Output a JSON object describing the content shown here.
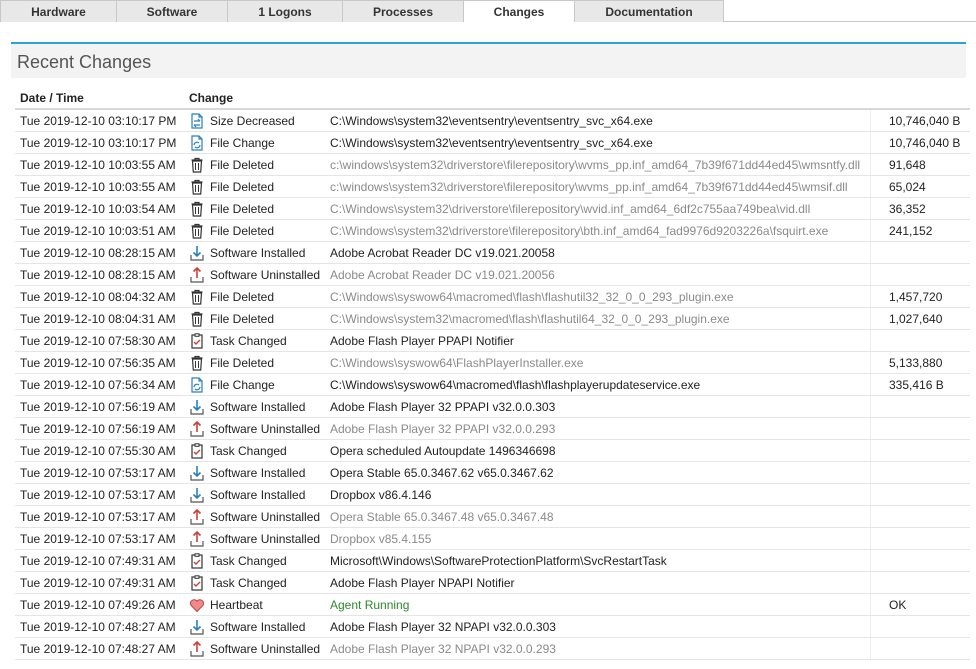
{
  "tabs": [
    {
      "label": "Hardware",
      "active": false
    },
    {
      "label": "Software",
      "active": false
    },
    {
      "label": "1 Logons",
      "active": false
    },
    {
      "label": "Processes",
      "active": false
    },
    {
      "label": "Changes",
      "active": true
    },
    {
      "label": "Documentation",
      "active": false
    }
  ],
  "section": {
    "title": "Recent Changes"
  },
  "table": {
    "headers": {
      "date": "Date / Time",
      "change": "Change"
    },
    "rows": [
      {
        "date": "Tue 2019-12-10 03:10:17 PM",
        "icon": "size-icon",
        "type": "Size Decreased",
        "object": "C:\\Windows\\system32\\eventsentry\\eventsentry_svc_x64.exe",
        "size": "10,746,040 B",
        "style": "normal"
      },
      {
        "date": "Tue 2019-12-10 03:10:17 PM",
        "icon": "file-change-icon",
        "type": "File Change",
        "object": "C:\\Windows\\system32\\eventsentry\\eventsentry_svc_x64.exe",
        "size": "10,746,040 B",
        "style": "normal"
      },
      {
        "date": "Tue 2019-12-10 10:03:55 AM",
        "icon": "trash-icon",
        "type": "File Deleted",
        "object": "c:\\windows\\system32\\driverstore\\filerepository\\wvms_pp.inf_amd64_7b39f671dd44ed45\\wmsntfy.dll",
        "size": "91,648",
        "style": "dim"
      },
      {
        "date": "Tue 2019-12-10 10:03:55 AM",
        "icon": "trash-icon",
        "type": "File Deleted",
        "object": "c:\\windows\\system32\\driverstore\\filerepository\\wvms_pp.inf_amd64_7b39f671dd44ed45\\wmsif.dll",
        "size": "65,024",
        "style": "dim"
      },
      {
        "date": "Tue 2019-12-10 10:03:54 AM",
        "icon": "trash-icon",
        "type": "File Deleted",
        "object": "C:\\Windows\\system32\\driverstore\\filerepository\\wvid.inf_amd64_6df2c755aa749bea\\vid.dll",
        "size": "36,352",
        "style": "dim"
      },
      {
        "date": "Tue 2019-12-10 10:03:51 AM",
        "icon": "trash-icon",
        "type": "File Deleted",
        "object": "C:\\Windows\\system32\\driverstore\\filerepository\\bth.inf_amd64_fad9976d9203226a\\fsquirt.exe",
        "size": "241,152",
        "style": "dim"
      },
      {
        "date": "Tue 2019-12-10 08:28:15 AM",
        "icon": "install-icon",
        "type": "Software Installed",
        "object": "Adobe Acrobat Reader DC v19.021.20058",
        "size": "",
        "style": "normal"
      },
      {
        "date": "Tue 2019-12-10 08:28:15 AM",
        "icon": "uninstall-icon",
        "type": "Software Uninstalled",
        "object": "Adobe Acrobat Reader DC v19.021.20056",
        "size": "",
        "style": "dim"
      },
      {
        "date": "Tue 2019-12-10 08:04:32 AM",
        "icon": "trash-icon",
        "type": "File Deleted",
        "object": "C:\\Windows\\syswow64\\macromed\\flash\\flashutil32_32_0_0_293_plugin.exe",
        "size": "1,457,720",
        "style": "dim"
      },
      {
        "date": "Tue 2019-12-10 08:04:31 AM",
        "icon": "trash-icon",
        "type": "File Deleted",
        "object": "C:\\Windows\\system32\\macromed\\flash\\flashutil64_32_0_0_293_plugin.exe",
        "size": "1,027,640",
        "style": "dim"
      },
      {
        "date": "Tue 2019-12-10 07:58:30 AM",
        "icon": "task-icon",
        "type": "Task Changed",
        "object": "Adobe Flash Player PPAPI Notifier",
        "size": "",
        "style": "normal"
      },
      {
        "date": "Tue 2019-12-10 07:56:35 AM",
        "icon": "trash-icon",
        "type": "File Deleted",
        "object": "C:\\Windows\\syswow64\\FlashPlayerInstaller.exe",
        "size": "5,133,880",
        "style": "dim"
      },
      {
        "date": "Tue 2019-12-10 07:56:34 AM",
        "icon": "file-change-icon",
        "type": "File Change",
        "object": "C:\\Windows\\syswow64\\macromed\\flash\\flashplayerupdateservice.exe",
        "size": "335,416 B",
        "style": "normal"
      },
      {
        "date": "Tue 2019-12-10 07:56:19 AM",
        "icon": "install-icon",
        "type": "Software Installed",
        "object": "Adobe Flash Player 32 PPAPI v32.0.0.303",
        "size": "",
        "style": "normal"
      },
      {
        "date": "Tue 2019-12-10 07:56:19 AM",
        "icon": "uninstall-icon",
        "type": "Software Uninstalled",
        "object": "Adobe Flash Player 32 PPAPI v32.0.0.293",
        "size": "",
        "style": "dim"
      },
      {
        "date": "Tue 2019-12-10 07:55:30 AM",
        "icon": "task-icon",
        "type": "Task Changed",
        "object": "Opera scheduled Autoupdate 1496346698",
        "size": "",
        "style": "normal"
      },
      {
        "date": "Tue 2019-12-10 07:53:17 AM",
        "icon": "install-icon",
        "type": "Software Installed",
        "object": "Opera Stable 65.0.3467.62 v65.0.3467.62",
        "size": "",
        "style": "normal"
      },
      {
        "date": "Tue 2019-12-10 07:53:17 AM",
        "icon": "install-icon",
        "type": "Software Installed",
        "object": "Dropbox v86.4.146",
        "size": "",
        "style": "normal"
      },
      {
        "date": "Tue 2019-12-10 07:53:17 AM",
        "icon": "uninstall-icon",
        "type": "Software Uninstalled",
        "object": "Opera Stable 65.0.3467.48 v65.0.3467.48",
        "size": "",
        "style": "dim"
      },
      {
        "date": "Tue 2019-12-10 07:53:17 AM",
        "icon": "uninstall-icon",
        "type": "Software Uninstalled",
        "object": "Dropbox v85.4.155",
        "size": "",
        "style": "dim"
      },
      {
        "date": "Tue 2019-12-10 07:49:31 AM",
        "icon": "task-icon",
        "type": "Task Changed",
        "object": "Microsoft\\Windows\\SoftwareProtectionPlatform\\SvcRestartTask",
        "size": "",
        "style": "normal"
      },
      {
        "date": "Tue 2019-12-10 07:49:31 AM",
        "icon": "task-icon",
        "type": "Task Changed",
        "object": "Adobe Flash Player NPAPI Notifier",
        "size": "",
        "style": "normal"
      },
      {
        "date": "Tue 2019-12-10 07:49:26 AM",
        "icon": "heart-icon",
        "type": "Heartbeat",
        "object": "Agent Running",
        "size": "OK",
        "style": "green"
      },
      {
        "date": "Tue 2019-12-10 07:48:27 AM",
        "icon": "install-icon",
        "type": "Software Installed",
        "object": "Adobe Flash Player 32 NPAPI v32.0.0.303",
        "size": "",
        "style": "normal"
      },
      {
        "date": "Tue 2019-12-10 07:48:27 AM",
        "icon": "uninstall-icon",
        "type": "Software Uninstalled",
        "object": "Adobe Flash Player 32 NPAPI v32.0.0.293",
        "size": "",
        "style": "dim"
      }
    ]
  },
  "colors": {
    "accent": "#2aa3d6",
    "install": "#2a7fc0",
    "uninstall": "#d0403a",
    "heart": "#e05a5a",
    "agent": "#2a8a2a"
  }
}
